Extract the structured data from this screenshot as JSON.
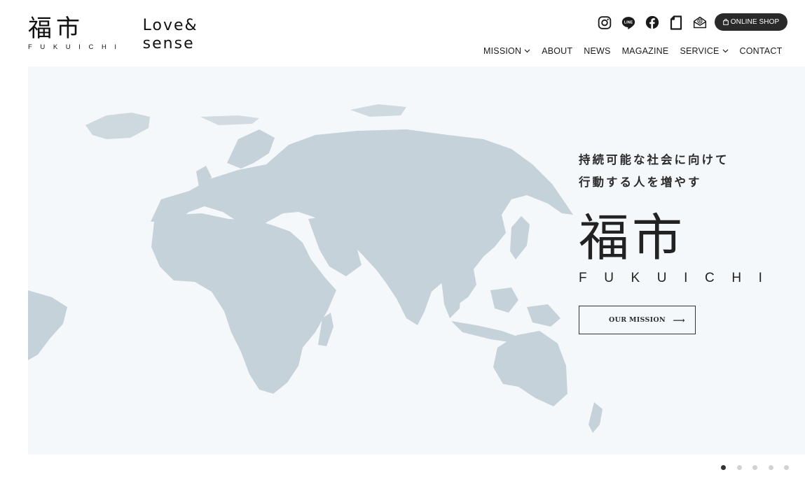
{
  "header": {
    "logo": {
      "kanji": "福市",
      "roman": "FUKUICHI",
      "sub_line1": "Love&",
      "sub_line2": "sense"
    },
    "social_icons": [
      "instagram-icon",
      "line-icon",
      "facebook-icon",
      "note-icon",
      "mail-icon"
    ],
    "online_shop_label": "ONLINE SHOP",
    "nav": {
      "mission": "MISSION",
      "about": "ABOUT",
      "news": "NEWS",
      "magazine": "MAGAZINE",
      "service": "SERVICE",
      "contact": "CONTACT"
    }
  },
  "hero": {
    "tagline_line1": "持続可能な社会に向けて",
    "tagline_line2": "行動する人を増やす",
    "logo_kanji": "福市",
    "logo_roman": "FUKUICHI",
    "mission_button": "OUR MISSION",
    "mission_arrow": "⟶"
  },
  "slider": {
    "count": 5,
    "active_index": 0
  },
  "colors": {
    "map_land": "#c6d2d9",
    "hero_background": "#f5f8fa",
    "shop_button": "#2a2a2a",
    "active_dot": "#333333",
    "inactive_dot": "#d2d2d2"
  }
}
